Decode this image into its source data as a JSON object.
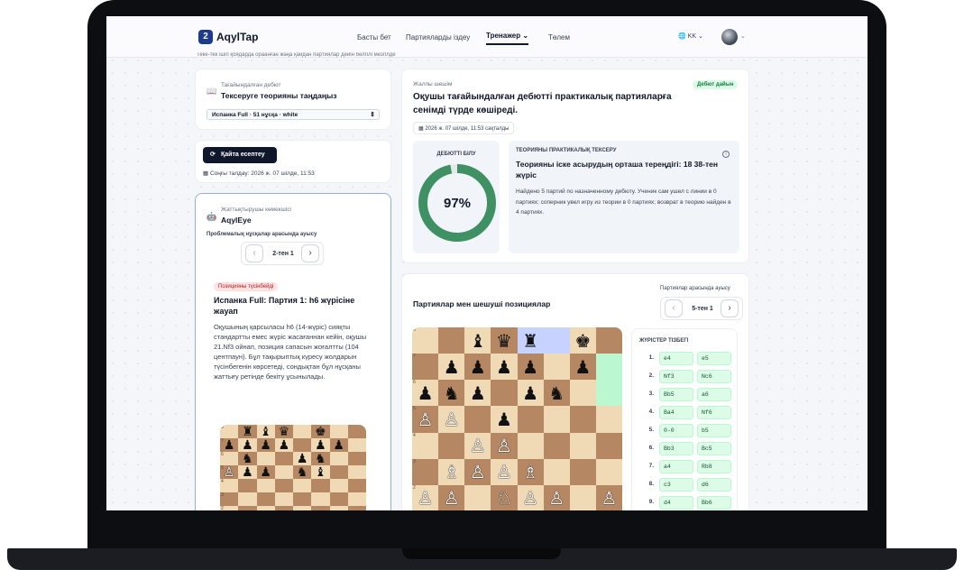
{
  "nav": {
    "logo": "AqylTap",
    "links": [
      "Басты бет",
      "Партияларды іздеу",
      "Тренажер",
      "Төлем"
    ],
    "lang": "KK",
    "strip_text": "Теке-тек ішіп қоядарда ораанған жаңа қайдан партиялар дейін белгілі мезгілде"
  },
  "debut_card": {
    "label": "Тағайындалған дебют",
    "title": "Тексеруге теорияны таңдаңыз",
    "select_value": "Испанка Full · 51 нұсқа · white"
  },
  "recalc": {
    "button": "Қайта есептеу",
    "last": "Соңғы талдау: 2026 ж. 07 шілде, 11:53"
  },
  "assistant": {
    "label": "Жаттықтырушы көмекшісі",
    "name": "AqylEye",
    "switch_label": "Проблемалық нұсқалар арасында ауысу",
    "pager": "2-тен 1",
    "tag": "Позицияны түсінбейді",
    "title": "Испанка Full: Партия 1: h6 жүрісіне жауап",
    "body": "Оқушының қарсыласы h6 (14-жүріс) сияқты стандартты емес жүріс жасағаннан кейін, оқушы 21.Nf3 ойнап, позиция сапасын жоғалтты (104 центпаун). Бұл тақырыптық күресу жолдарын түсінбегенін көрсетеді, сондықтан бұл нұсқаны жаттығу ретінде бекіту ұсынылады."
  },
  "solution": {
    "label": "Жалпы шешім",
    "badge": "Дебют дайын",
    "title": "Оқушы тағайындалған дебютті практикалық партияларға сенімді түрде көшіреді.",
    "date": "2026 ж. 07 шілде, 11:53 сақталды",
    "knowledge_label": "ДЕБЮТТІ БІЛУ",
    "knowledge_value": "97%",
    "knowledge_pct": 97,
    "theory_label": "ТЕОРИЯНЫ ПРАКТИКАЛЫҚ ТЕКСЕРУ",
    "theory_title": "Теорияны іске асырудың орташа тереңдігі: 18 38-тен жүріс",
    "theory_body": "Найдено 5 партий по назначенному дебюту. Ученик сам ушел с линии в 0 партиях; соперник увел игру из теории в 0 партиях; возврат в теорию найден в 4 партиях."
  },
  "games": {
    "title": "Партиялар мен шешуші позициялар",
    "switch_label": "Партиялар арасында ауысу",
    "pager": "5-тен 1",
    "moves_label": "ЖҮРІСТЕР ТІЗБЕГІ",
    "moves": [
      {
        "n": "1.",
        "w": "e4",
        "b": "e5"
      },
      {
        "n": "2.",
        "w": "Nf3",
        "b": "Nc6"
      },
      {
        "n": "3.",
        "w": "Bb5",
        "b": "a6"
      },
      {
        "n": "4.",
        "w": "Ba4",
        "b": "Nf6"
      },
      {
        "n": "5.",
        "w": "0-0",
        "b": "b5"
      },
      {
        "n": "6.",
        "w": "Bb3",
        "b": "Bc5"
      },
      {
        "n": "7.",
        "w": "a4",
        "b": "Rb8"
      },
      {
        "n": "8.",
        "w": "c3",
        "b": "d6"
      },
      {
        "n": "9.",
        "w": "d4",
        "b": "Bb6"
      }
    ]
  },
  "colors": {
    "accent": "#1e3a8a",
    "ring": "#3f9163",
    "move_bg": "#dcfce7"
  }
}
